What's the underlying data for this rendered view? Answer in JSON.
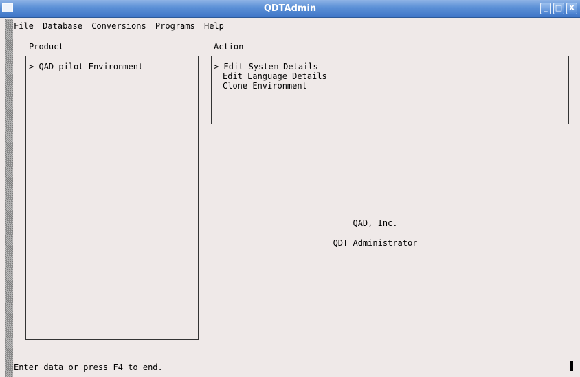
{
  "window": {
    "title": "QDTAdmin",
    "controls": {
      "minimize": "_",
      "maximize": "□",
      "close": "X"
    }
  },
  "menu": [
    {
      "first": "F",
      "rest": "ile"
    },
    {
      "first": "D",
      "rest": "atabase"
    },
    {
      "first": "Co",
      "mid": "n",
      "rest": "versions"
    },
    {
      "first": "P",
      "rest": "rograms"
    },
    {
      "first": "H",
      "rest": "elp"
    }
  ],
  "product": {
    "label": "Product",
    "items": [
      {
        "marker": ">",
        "text": "QAD pilot Environment"
      }
    ]
  },
  "action": {
    "label": "Action",
    "items": [
      {
        "marker": ">",
        "text": "Edit System Details"
      },
      {
        "marker": "",
        "text": "Edit Language Details"
      },
      {
        "marker": "",
        "text": "Clone Environment"
      }
    ]
  },
  "info": {
    "company": "QAD, Inc.",
    "app": "QDT Administrator"
  },
  "status": {
    "message": "Enter data or press F4 to end."
  }
}
